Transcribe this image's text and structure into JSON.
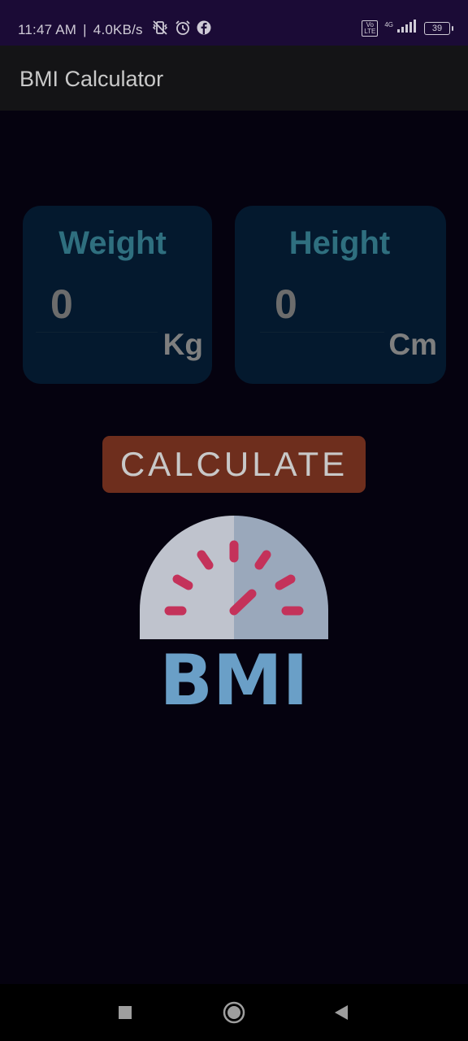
{
  "status_bar": {
    "time": "11:47 AM",
    "separator": "|",
    "speed": "4.0KB/s",
    "network_gen": "4G",
    "volte": "Vo\nLTE",
    "battery": "39",
    "icons": [
      "vibrate-off-icon",
      "alarm-icon",
      "facebook-icon",
      "signal-icon",
      "battery-icon"
    ]
  },
  "app_bar": {
    "title": "BMI Calculator"
  },
  "weight_card": {
    "title": "Weight",
    "value": "0",
    "unit": "Kg"
  },
  "height_card": {
    "title": "Height",
    "value": "0",
    "unit": "Cm"
  },
  "calculate_button": {
    "label": "CALCULATE"
  },
  "logo": {
    "text": "BMI"
  },
  "nav_bar": {
    "icons": [
      "recents-icon",
      "home-icon",
      "back-icon"
    ]
  },
  "colors": {
    "background": "#05020f",
    "status_bar": "#1b0b36",
    "app_bar": "#141416",
    "card": "#04192e",
    "card_title": "#2f6f7f",
    "button": "#6e2e1d",
    "logo_text": "#6a9fc7",
    "gauge_marks": "#c4325a"
  }
}
